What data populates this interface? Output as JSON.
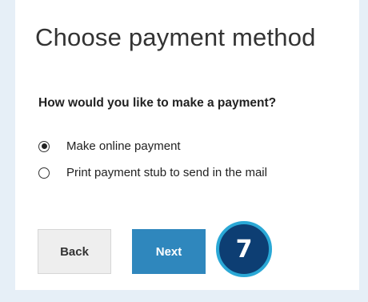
{
  "page": {
    "title": "Choose payment method",
    "question": "How would you like to make a payment?"
  },
  "options": [
    {
      "label": "Make online payment",
      "selected": true
    },
    {
      "label": "Print payment stub to send in the mail",
      "selected": false
    }
  ],
  "buttons": {
    "back_label": "Back",
    "next_label": "Next"
  },
  "step_badge": {
    "number": "7"
  },
  "colors": {
    "background": "#e6eff7",
    "primary_button": "#2f87bd",
    "badge_fill": "#0d3e73",
    "badge_ring": "#2aa8d6"
  }
}
